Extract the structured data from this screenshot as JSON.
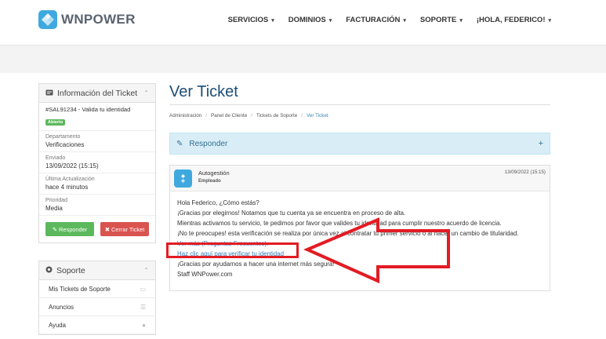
{
  "header": {
    "logo_text": "WNPOWER",
    "nav": [
      {
        "label": "SERVICIOS"
      },
      {
        "label": "DOMINIOS"
      },
      {
        "label": "FACTURACIÓN"
      },
      {
        "label": "SOPORTE"
      },
      {
        "label": "¡HOLA, FEDERICO!"
      }
    ]
  },
  "sidebar": {
    "ticket_panel_title": "Información del Ticket",
    "ticket_ref": "#SAL91234 - Valida tu identidad",
    "status_badge": "Abierto",
    "department_label": "Departamento",
    "department_value": "Verificaciones",
    "sent_label": "Enviado",
    "sent_value": "13/09/2022 (15:15)",
    "last_update_label": "Última Actualización",
    "last_update_value": "hace 4 minutos",
    "priority_label": "Prioridad",
    "priority_value": "Media",
    "reply_button": "Responder",
    "close_button": "Cerrar Ticket",
    "support_panel_title": "Soporte",
    "support_items": [
      {
        "label": "Mis Tickets de Soporte"
      },
      {
        "label": "Anuncios"
      },
      {
        "label": "Ayuda"
      }
    ]
  },
  "main": {
    "title": "Ver Ticket",
    "breadcrumb": [
      {
        "label": "Administración"
      },
      {
        "label": "Panel de Cliente"
      },
      {
        "label": "Tickets de Soporte"
      },
      {
        "label": "Ver Ticket"
      }
    ],
    "reply_bar_label": "Responder",
    "reply_bar_toggle": "+",
    "message": {
      "author": "Autogestión",
      "role": "Empleado",
      "date": "13/09/2022 (15:15)",
      "line1": "Hola Federico, ¿Cómo estás?",
      "line2": "¡Gracias por elegirnos! Notamos que tu cuenta ya se encuentra en proceso de alta.",
      "line3": "Mientras activamos tu servicio, te pedimos por favor que valides tu identidad para cumplir nuestro acuerdo de licencia.",
      "line4": "¡No te preocupes! esta verificación se realiza por única vez al contratar tu primer servicio o al hacer un cambio de titularidad.",
      "line5_link": "Ver más (Preguntas Frecuentes)",
      "line5_end": ".",
      "verify_link": "Haz clic aquí para verificar tu identidad",
      "line7": "¡Gracias por ayudarnos a hacer una internet más segura!",
      "signature": "Staff WNPower.com"
    }
  },
  "colors": {
    "brand": "#3fa9df",
    "title": "#1c4d76",
    "link": "#337ab7",
    "success": "#5cb85c",
    "danger": "#d9534f",
    "annotation": "#e31b23"
  }
}
